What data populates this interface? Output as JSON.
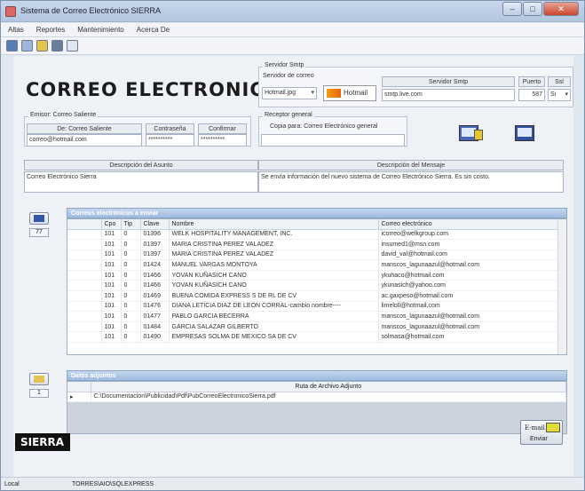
{
  "window": {
    "title": "Sistema de Correo Electrónico SIERRA",
    "buttons": {
      "minimize": "–",
      "maximize": "□",
      "close": "✕"
    }
  },
  "menu": [
    "Altas",
    "Reportes",
    "Mantenimiento",
    "Acerca De"
  ],
  "toolbar_icons": [
    "user-icon",
    "window-icon",
    "folder-icon",
    "print-icon",
    "document-icon"
  ],
  "header": {
    "title": "CORREO ELECTRONICO"
  },
  "smtp": {
    "legend": "Servidor Smtp",
    "selector_label": "Servidor de correo",
    "selected": "Hotmail.jpg",
    "hotmail_label": "Hotmail",
    "server_col": "Servidor Smtp",
    "server_value": "smtp.live.com",
    "port_col": "Puerto",
    "port_value": "587",
    "ssl_col": "Ssl",
    "ssl_value": "Si"
  },
  "sender": {
    "legend": "Emisor: Correo Saliente",
    "email_col": "De: Correo Saliente",
    "email_value": "correo@hotmail.com",
    "password_col": "Contraseña",
    "password_value": "**********",
    "confirm_col": "Confirmar",
    "confirm_value": "**********"
  },
  "receiver": {
    "legend": "Receptor general",
    "copy_label": "Copia para:  Correo Electrónico general",
    "copy_value": ""
  },
  "subject": {
    "col": "Descripción del Asunto",
    "value": "Correo Electrónico Sierra"
  },
  "message": {
    "col": "Descripción del Mensaje",
    "value": "Se envía información del nuevo sistema de Correo Electrónico Sierra.  Es sin costo."
  },
  "recipients": {
    "section_title": "Correos electrónicos a enviar",
    "count": "77",
    "columns": [
      "Cpo",
      "Tip",
      "Clave",
      "Nombre",
      "Correo electrónico"
    ],
    "rows": [
      [
        "101",
        "0",
        "01396",
        "WELK HOSPITALITY MANAGEMENT, INC.",
        "icorreo@welkgroup.com"
      ],
      [
        "101",
        "0",
        "01397",
        "MARIA CRISTINA PEREZ VALADEZ",
        "insumed1@msn.com"
      ],
      [
        "101",
        "0",
        "01397",
        "MARIA CRISTINA PEREZ VALADEZ",
        "david_val@hotmail.com"
      ],
      [
        "101",
        "0",
        "01424",
        "MANUEL VARGAS MONTOYA",
        "manscos_lagunaazul@hotmail.com"
      ],
      [
        "101",
        "0",
        "01466",
        "YOVAN KUÑASICH CANO",
        "ykuhaco@hotmail.com"
      ],
      [
        "101",
        "0",
        "01466",
        "YOVAN KUÑASICH CANO",
        "ykunasich@yahoo.com"
      ],
      [
        "101",
        "0",
        "01469",
        "BUENA COMIDA EXPRESS S DE RL DE CV",
        "ac.gaxpeso@hotmail.com"
      ],
      [
        "101",
        "0",
        "01476",
        "DIANA LETICIA DIAZ DE LEON CORRAL-cambio nombre----",
        "limeloll@hotmail.com"
      ],
      [
        "101",
        "0",
        "01477",
        "PABLO GARCIA BECERRA",
        "manscos_lagunaazul@hotmail.com"
      ],
      [
        "101",
        "0",
        "01484",
        "GARCIA SALAZAR GILBERTO",
        "manscos_lagunaazul@hotmail.com"
      ],
      [
        "101",
        "0",
        "01490",
        "EMPRESAS SOLMA DE MEXICO SA DE CV",
        "solmasa@hotmail.com"
      ]
    ]
  },
  "attachments": {
    "section_title": "Datos adjuntos",
    "count": "1",
    "column": "Ruta de Archivo Adjunto",
    "rows": [
      "C:\\Documentacion\\Publicidad\\Pdf\\PubCorreoElectronicoSierra.pdf"
    ]
  },
  "brand": {
    "logo": "SIERRA"
  },
  "send_button": {
    "label1": "E-mail",
    "label2": "Enviar"
  },
  "status": {
    "left": "Local",
    "server": "TORRES\\AIO\\SQLEXPRESS"
  }
}
